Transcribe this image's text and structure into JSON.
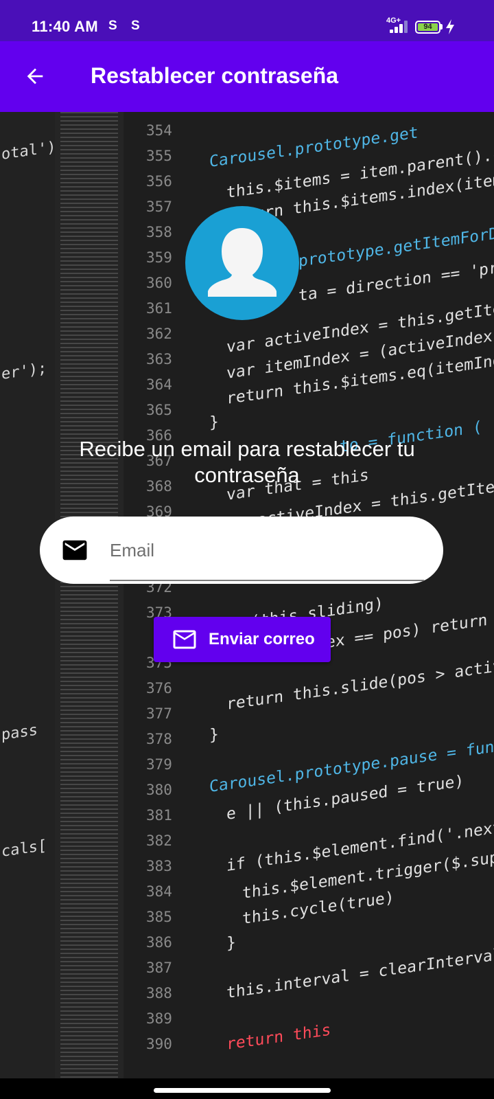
{
  "status_bar": {
    "time": "11:40 AM",
    "sync_icon_1": "S",
    "sync_icon_2": "S",
    "network": "4G+",
    "battery": "94"
  },
  "app_bar": {
    "title": "Restablecer contraseña",
    "back_icon": "arrow-back-icon"
  },
  "background": {
    "line_numbers": [
      "354",
      "355",
      "356",
      "357",
      "358",
      "359",
      "360",
      "361",
      "362",
      "363",
      "364",
      "365",
      "366",
      "367",
      "368",
      "369",
      "372",
      "373",
      "375",
      "376",
      "377",
      "378",
      "379",
      "380",
      "381",
      "382",
      "383",
      "384",
      "385",
      "386",
      "387",
      "388",
      "389",
      "390"
    ],
    "code_lines": [
      "Carousel.prototype.get",
      "this.$items = item.parent().chi",
      "return this.$items.index(item ||",
      "prototype.getItemForDirec",
      "ta = direction == 'prev'",
      "var activeIndex = this.getItemI",
      "var itemIndex = (activeIndex + d",
      "return this.$items.eq(itemIndex)",
      "}",
      "to = function (",
      "var that = this",
      "activeIndex = this.getItemIn",
      "(this.sliding)",
      "ex == pos) return t",
      "return this.slide(pos > activeIn",
      "}",
      "Carousel.prototype.pause = functio",
      "e || (this.paused = true)",
      "if (this.$element.find('.next, .",
      "this.$element.trigger($.suppor",
      "this.cycle(true)",
      "}",
      "this.interval = clearInterval(th",
      "return this"
    ],
    "side_code": [
      "otal');",
      "er');",
      "pass",
      "cals["
    ]
  },
  "main": {
    "avatar_icon": "person-avatar-icon",
    "description": "Recibe un email para restablecer tu contraseña",
    "email_field": {
      "icon": "mail-icon",
      "placeholder": "Email",
      "value": ""
    },
    "send_button": {
      "icon": "mail-outline-icon",
      "label": "Enviar correo"
    }
  },
  "colors": {
    "status_bar": "#4a0fb8",
    "app_bar": "#6200ee",
    "button": "#6200ee",
    "avatar": "#1aa0d4"
  }
}
